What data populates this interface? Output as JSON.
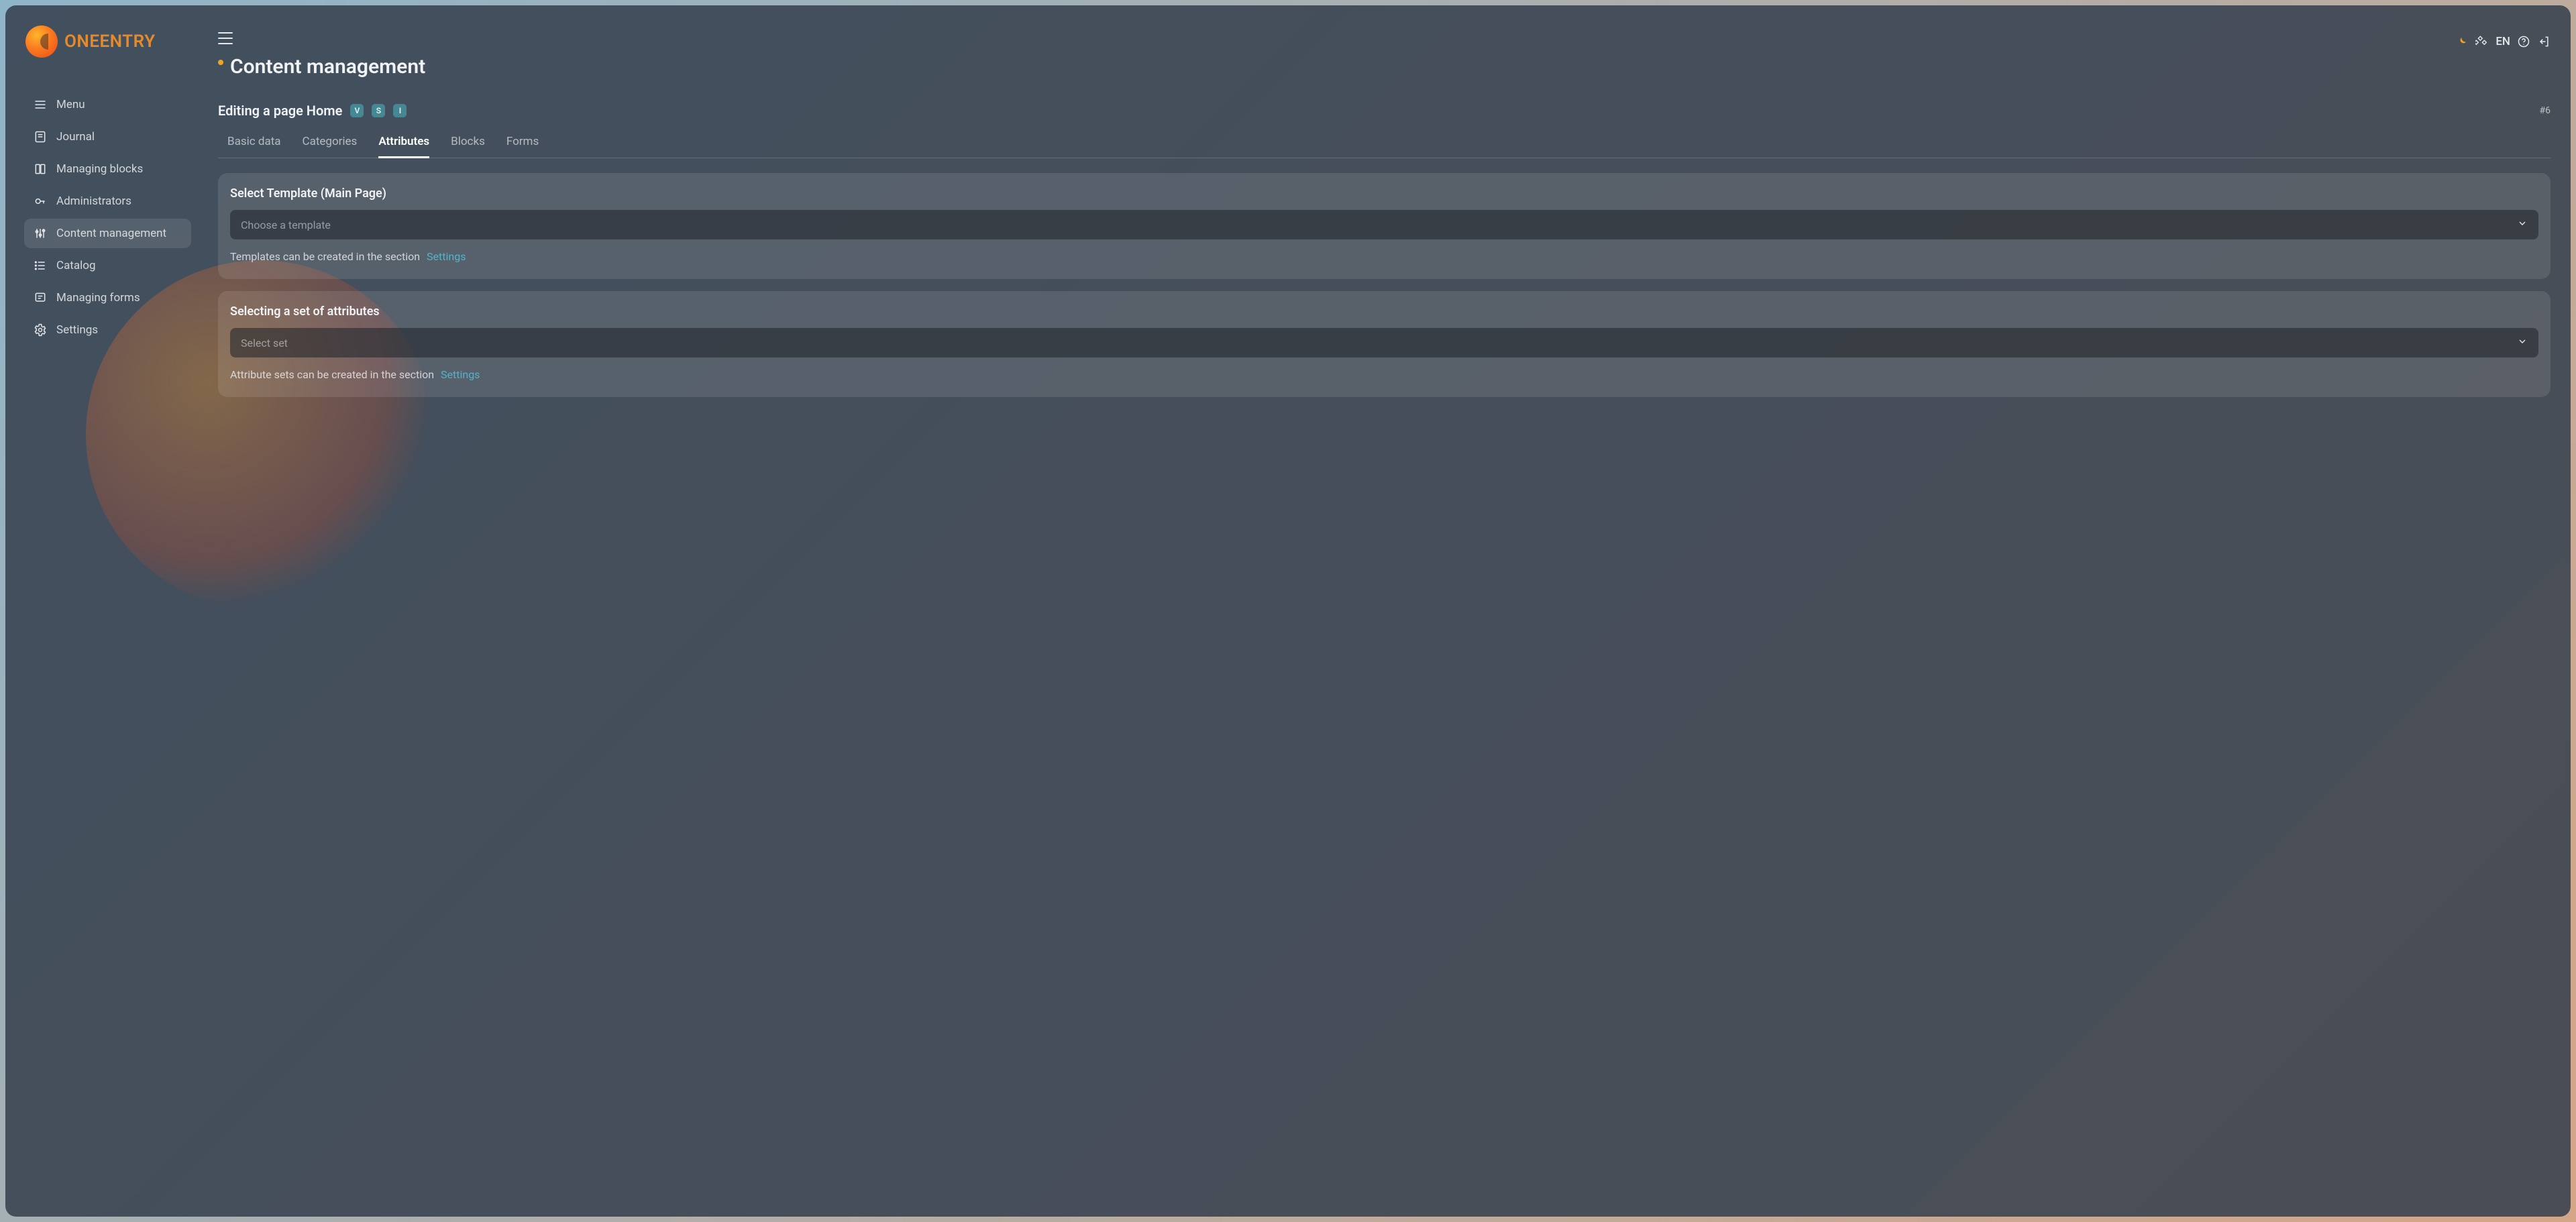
{
  "brand": "ONEENTRY",
  "header": {
    "title": "Content management",
    "language": "EN"
  },
  "sidebar": {
    "items": [
      {
        "label": "Menu"
      },
      {
        "label": "Journal"
      },
      {
        "label": "Managing blocks"
      },
      {
        "label": "Administrators"
      },
      {
        "label": "Content management"
      },
      {
        "label": "Catalog"
      },
      {
        "label": "Managing forms"
      },
      {
        "label": "Settings"
      }
    ]
  },
  "subheader": {
    "title": "Editing a page Home",
    "badges": [
      "V",
      "S",
      "I"
    ],
    "page_id": "#6"
  },
  "tabs": [
    {
      "label": "Basic data"
    },
    {
      "label": "Categories"
    },
    {
      "label": "Attributes"
    },
    {
      "label": "Blocks"
    },
    {
      "label": "Forms"
    }
  ],
  "cards": {
    "template": {
      "title": "Select Template (Main Page)",
      "placeholder": "Choose a template",
      "hint_text": "Templates can be created in the section",
      "hint_link": "Settings"
    },
    "attributes": {
      "title": "Selecting a set of attributes",
      "placeholder": "Select set",
      "hint_text": "Attribute sets can be created in the section",
      "hint_link": "Settings"
    }
  }
}
